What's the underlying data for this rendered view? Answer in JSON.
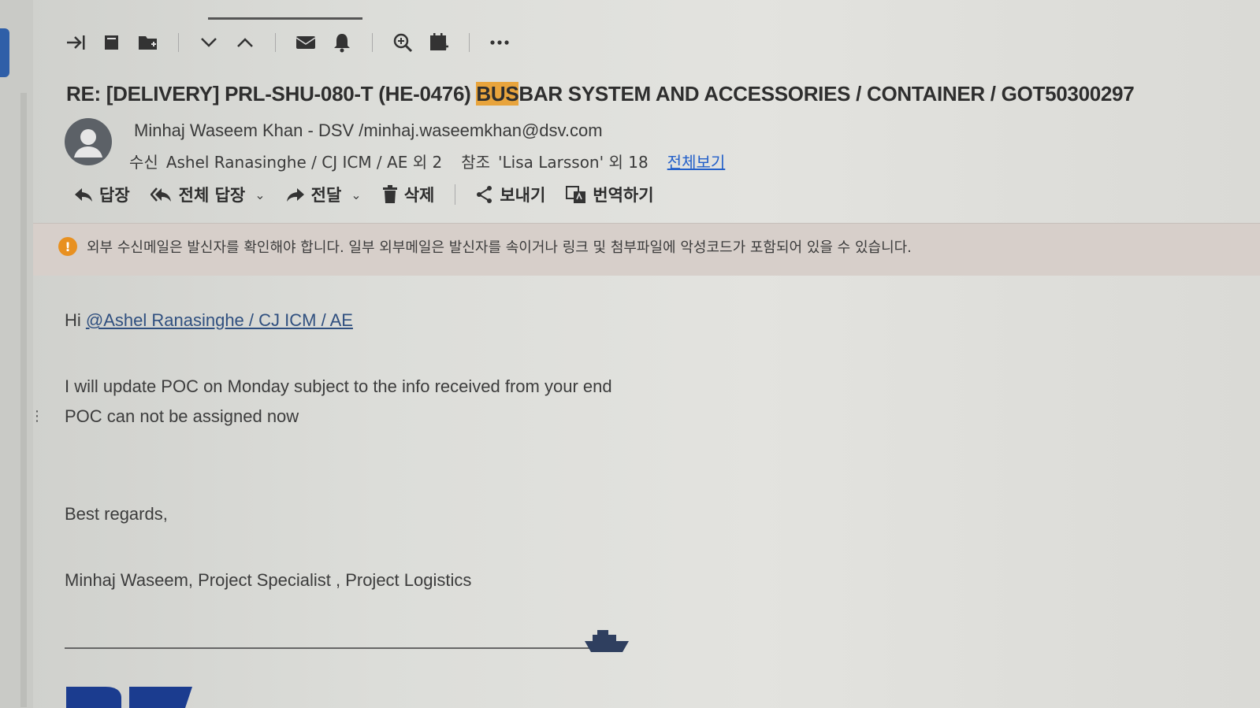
{
  "toolbar": {
    "icons": [
      "move-to-icon",
      "archive-icon",
      "move-folder-icon",
      "next-icon",
      "previous-icon",
      "mail-icon",
      "notification-icon",
      "zoom-icon",
      "calendar-icon",
      "more-icon"
    ]
  },
  "email": {
    "subject_prefix": "RE: [DELIVERY] PRL-SHU-080-T (HE-0476) ",
    "subject_highlight": "BUS",
    "subject_rest": "BAR SYSTEM AND ACCESSORIES / CONTAINER / GOT50300297",
    "sender": "Minhaj Waseem Khan - DSV /minhaj.waseemkhan@dsv.com",
    "to_label": "수신",
    "to_value": "Ashel Ranasinghe / CJ ICM / AE 외 2",
    "cc_label": "참조",
    "cc_value": "'Lisa Larsson' 외 18",
    "view_all": "전체보기"
  },
  "actions": {
    "reply": "답장",
    "reply_all": "전체 답장",
    "forward": "전달",
    "delete": "삭제",
    "share": "보내기",
    "translate": "번역하기"
  },
  "warning": {
    "text": "외부 수신메일은 발신자를 확인해야 합니다. 일부 외부메일은 발신자를 속이거나 링크 및 첨부파일에 악성코드가 포함되어 있을 수 있습니다."
  },
  "body": {
    "greeting": "Hi ",
    "mention": "@Ashel Ranasinghe / CJ ICM / AE",
    "line1": "I will update POC on Monday subject to the info received from your end",
    "line2": "POC can not be assigned now",
    "closing": "Best regards,",
    "signature": "Minhaj Waseem, Project Specialist , Project Logistics"
  },
  "colors": {
    "highlight": "#e8a43c",
    "link": "#2460c9",
    "brand": "#1b3c8f",
    "warning_icon": "#e89020"
  }
}
